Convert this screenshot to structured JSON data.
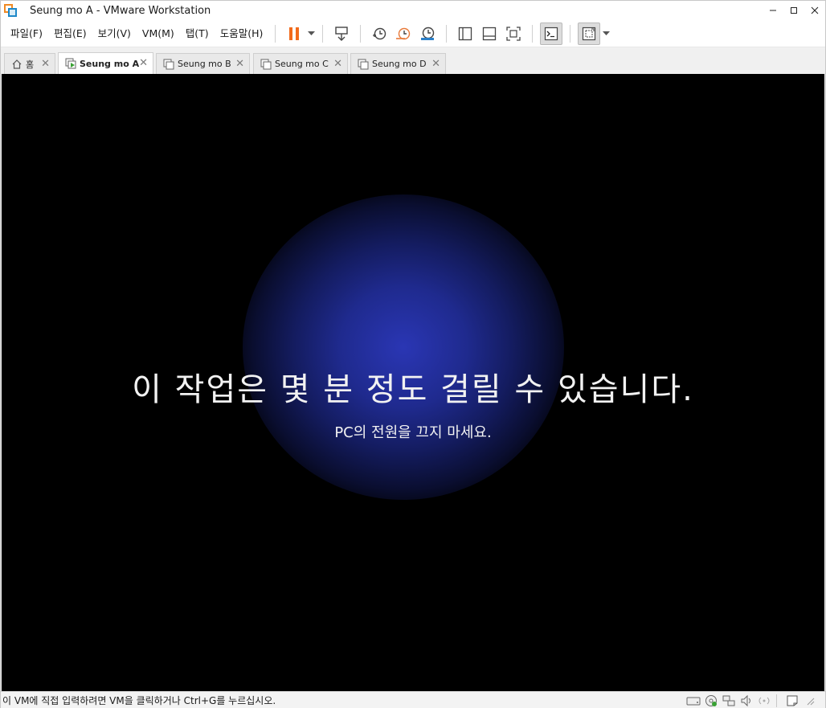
{
  "window": {
    "title": "Seung mo A - VMware Workstation"
  },
  "menu": [
    "파일(F)",
    "편집(E)",
    "보기(V)",
    "VM(M)",
    "탭(T)",
    "도움말(H)"
  ],
  "tabs": [
    {
      "label": "홈",
      "kind": "home"
    },
    {
      "label": "Seung mo A",
      "kind": "vm-running",
      "active": true
    },
    {
      "label": "Seung mo B",
      "kind": "vm"
    },
    {
      "label": "Seung mo C",
      "kind": "vm"
    },
    {
      "label": "Seung mo D",
      "kind": "vm"
    }
  ],
  "vm": {
    "message": "이 작업은 몇 분 정도 걸릴 수 있습니다.",
    "submessage": "PC의 전원을 끄지 마세요."
  },
  "status": {
    "text": "이 VM에 직접 입력하려면 VM을 클릭하거나 Ctrl+G를 누르십시오."
  },
  "colors": {
    "accent_orange": "#f26a1b",
    "screen_glow": "#2a36b4"
  }
}
